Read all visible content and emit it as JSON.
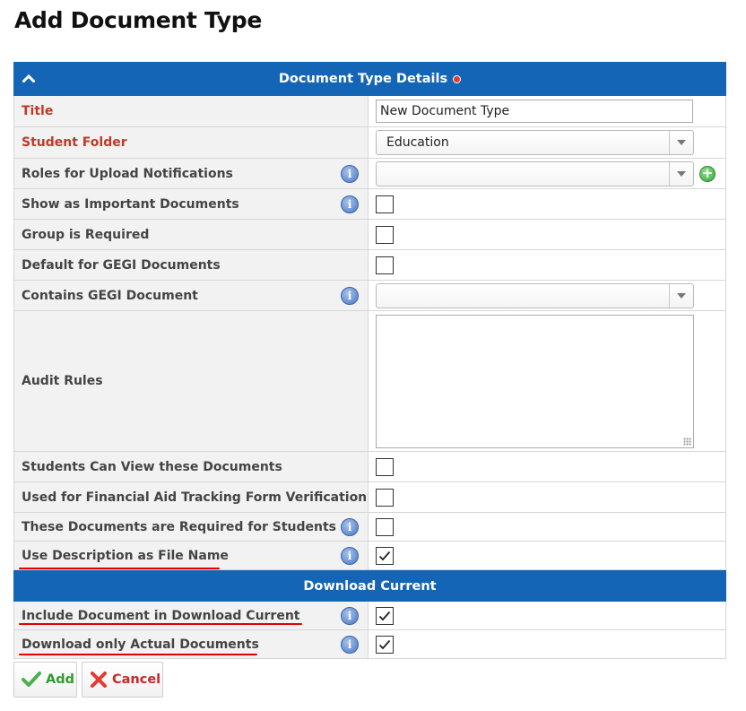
{
  "page": {
    "title": "Add Document Type"
  },
  "details_section": {
    "title": "Document Type Details"
  },
  "fields": {
    "title": {
      "label": "Title",
      "value": "New Document Type"
    },
    "student_folder": {
      "label": "Student Folder",
      "value": "Education"
    },
    "roles_upload": {
      "label": "Roles for Upload Notifications",
      "value": ""
    },
    "show_important": {
      "label": "Show as Important Documents",
      "checked": false
    },
    "group_required": {
      "label": "Group is Required",
      "checked": false
    },
    "default_gegi": {
      "label": "Default for GEGI Documents",
      "checked": false
    },
    "contains_gegi": {
      "label": "Contains GEGI Document",
      "value": ""
    },
    "audit_rules": {
      "label": "Audit Rules",
      "value": ""
    },
    "students_view": {
      "label": "Students Can View these Documents",
      "checked": false
    },
    "financial_aid": {
      "label": "Used for Financial Aid Tracking Form Verification",
      "checked": false
    },
    "required_students": {
      "label": "These Documents are Required for Students",
      "checked": false
    },
    "use_description": {
      "label": "Use Description as File Name",
      "checked": true
    }
  },
  "download_section": {
    "title": "Download Current"
  },
  "download_fields": {
    "include_download": {
      "label": "Include Document in Download Current",
      "checked": true
    },
    "download_actual": {
      "label": "Download only Actual Documents",
      "checked": true
    }
  },
  "buttons": {
    "add": "Add",
    "cancel": "Cancel"
  },
  "colors": {
    "header_blue": "#1565b6",
    "required_red": "#c0392b",
    "annotation_red": "#e00000"
  },
  "icons": {
    "info": "info-icon",
    "collapse": "chevron-up-icon",
    "add_role": "plus-circle-icon"
  }
}
